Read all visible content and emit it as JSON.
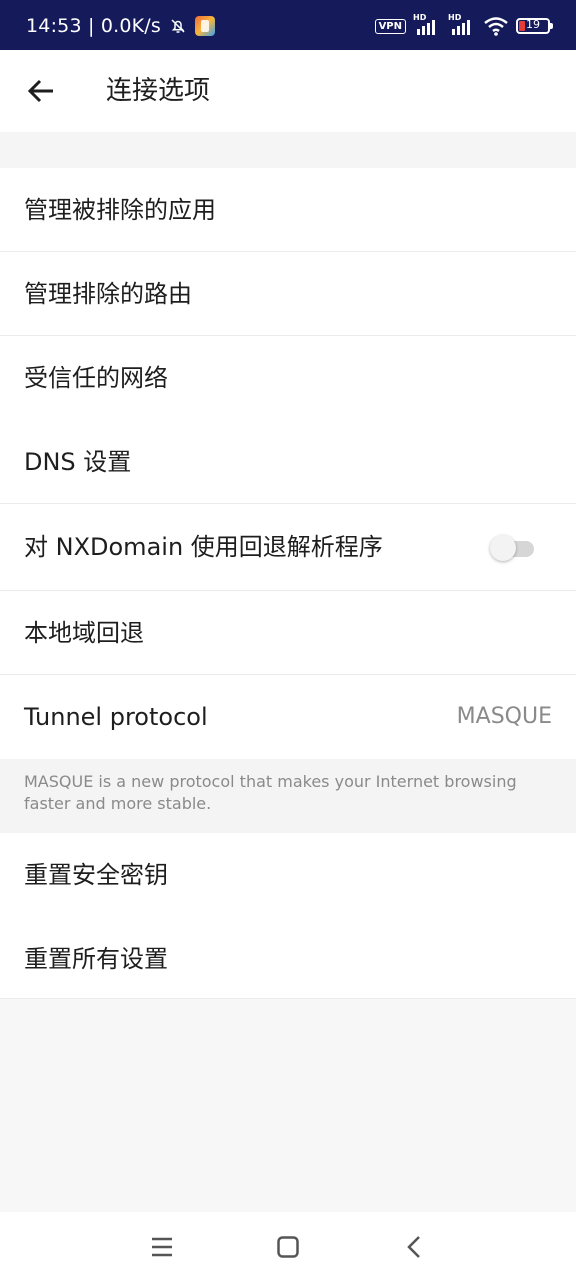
{
  "status_bar": {
    "time_speed": "14:53 | 0.0K/s",
    "vpn_label": "VPN",
    "signal_label_1": "HD",
    "signal_label_2": "HD",
    "battery_level": "19",
    "battery_color": "#e43b3b",
    "background_color": "#141a5a"
  },
  "app_bar": {
    "back_icon": "arrow-left-icon",
    "title": "连接选项"
  },
  "settings": {
    "manage_excluded_apps": "管理被排除的应用",
    "manage_excluded_routes": "管理排除的路由",
    "trusted_networks": "受信任的网络",
    "dns_settings": "DNS 设置",
    "nxdomain_fallback": "对 NXDomain 使用回退解析程序",
    "nxdomain_fallback_enabled": false,
    "local_domain_fallback": "本地域回退",
    "tunnel_protocol_label": "Tunnel protocol",
    "tunnel_protocol_value": "MASQUE",
    "tunnel_protocol_info": "MASQUE is a new protocol that makes your Internet browsing faster and more stable.",
    "reset_security_keys": "重置安全密钥",
    "reset_all_settings": "重置所有设置"
  },
  "nav_bar": {
    "menu_icon": "menu-icon",
    "home_icon": "home-square-icon",
    "back_icon": "back-chevron-icon"
  }
}
